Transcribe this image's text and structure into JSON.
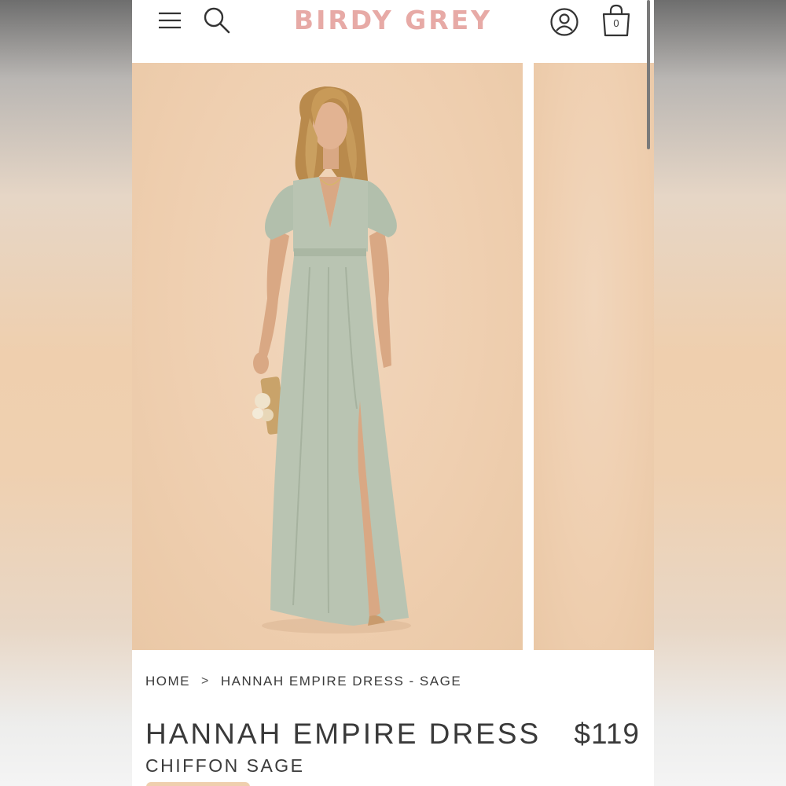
{
  "header": {
    "brand": "BIRDY GREY",
    "menu_icon": "hamburger-menu-icon",
    "search_icon": "search-icon",
    "account_icon": "account-icon",
    "bag_icon": "shopping-bag-icon",
    "bag_count": "0"
  },
  "breadcrumb": {
    "home": "HOME",
    "separator": ">",
    "current": "HANNAH EMPIRE DRESS - SAGE"
  },
  "product": {
    "title": "HANNAH EMPIRE DRESS",
    "price": "$119",
    "fabric_color": "CHIFFON SAGE"
  },
  "colors": {
    "brand": "#e7aaa6",
    "dress": "#b9c4b2",
    "backdrop": "#efcfb0",
    "text": "#3a3a3a"
  }
}
